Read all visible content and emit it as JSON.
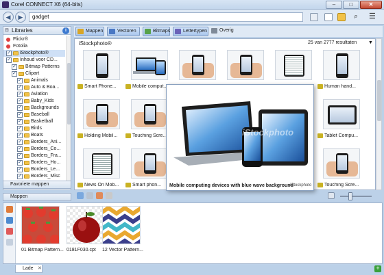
{
  "window": {
    "title": "Corel CONNECT X6 (64-bits)",
    "minimize": "–",
    "maximize": "□",
    "close": "✕"
  },
  "search": {
    "query": "gadget"
  },
  "libraries": {
    "title": "Libraries",
    "items": [
      {
        "label": "Flickr®",
        "kind": "dot",
        "color": "#e04040",
        "indent": 0,
        "checked": false
      },
      {
        "label": "Fotolia",
        "kind": "dot",
        "color": "#e04040",
        "indent": 0,
        "checked": false
      },
      {
        "label": "iStockphoto®",
        "kind": "cb",
        "indent": 0,
        "checked": true,
        "selected": true
      },
      {
        "label": "Inhoud voor CD...",
        "kind": "cb",
        "indent": 0,
        "checked": true
      },
      {
        "label": "Bitmap Patterns",
        "kind": "folder",
        "indent": 1,
        "checked": true
      },
      {
        "label": "Clipart",
        "kind": "folder",
        "indent": 1,
        "checked": true
      },
      {
        "label": "Animals",
        "kind": "folder",
        "indent": 2,
        "checked": true
      },
      {
        "label": "Auto & Boa...",
        "kind": "folder",
        "indent": 2,
        "checked": true
      },
      {
        "label": "Aviation",
        "kind": "folder",
        "indent": 2,
        "checked": true
      },
      {
        "label": "Baby_Kids",
        "kind": "folder",
        "indent": 2,
        "checked": true
      },
      {
        "label": "Backgrounds",
        "kind": "folder",
        "indent": 2,
        "checked": true
      },
      {
        "label": "Baseball",
        "kind": "folder",
        "indent": 2,
        "checked": true
      },
      {
        "label": "Basketball",
        "kind": "folder",
        "indent": 2,
        "checked": true
      },
      {
        "label": "Birds",
        "kind": "folder",
        "indent": 2,
        "checked": true
      },
      {
        "label": "Boats",
        "kind": "folder",
        "indent": 2,
        "checked": true
      },
      {
        "label": "Borders_Ani...",
        "kind": "folder",
        "indent": 2,
        "checked": true
      },
      {
        "label": "Borders_Co...",
        "kind": "folder",
        "indent": 2,
        "checked": true
      },
      {
        "label": "Borders_Fra...",
        "kind": "folder",
        "indent": 2,
        "checked": true
      },
      {
        "label": "Borders_Ho...",
        "kind": "folder",
        "indent": 2,
        "checked": true
      },
      {
        "label": "Borders_Le...",
        "kind": "folder",
        "indent": 2,
        "checked": true
      },
      {
        "label": "Borders_Misc",
        "kind": "folder",
        "indent": 2,
        "checked": true
      }
    ],
    "favorites": "Favoriete mappen",
    "folders": "Mappen"
  },
  "toolbar": {
    "tabs": [
      {
        "label": "Mappen",
        "color": "#d9a628",
        "active": true
      },
      {
        "label": "Vectoren",
        "color": "#4a78c4",
        "active": true
      },
      {
        "label": "Bitmaps",
        "color": "#58a24a",
        "active": true
      },
      {
        "label": "Lettertypen",
        "color": "#6a62b8",
        "active": true
      },
      {
        "label": "Overig",
        "color": "#7f8a98",
        "active": false
      }
    ]
  },
  "content": {
    "source": "iStockphoto®",
    "result_count": "25 van 2777 resultaten",
    "items": [
      {
        "caption": "Smart Phone..."
      },
      {
        "caption": "Mobile comput..."
      },
      {
        "caption": ""
      },
      {
        "caption": ""
      },
      {
        "caption": ""
      },
      {
        "caption": "Human hand..."
      },
      {
        "caption": "Holding Mobil..."
      },
      {
        "caption": "Touching Scre..."
      },
      {
        "caption": "Tablet Compu..."
      },
      {
        "caption": "News On Mob..."
      },
      {
        "caption": "Smart phon..."
      },
      {
        "caption": "Touching Scre..."
      }
    ],
    "preview": {
      "caption": "Mobile computing devices with blue wave background",
      "logo": "iStockphoto",
      "watermark": "iStockphoto"
    }
  },
  "tray": {
    "tab_label": "Lade",
    "items": [
      {
        "caption": "01 Bitmap Pattern..."
      },
      {
        "caption": "0181F030.cpt"
      },
      {
        "caption": "12 Vector Pattern..."
      }
    ]
  }
}
